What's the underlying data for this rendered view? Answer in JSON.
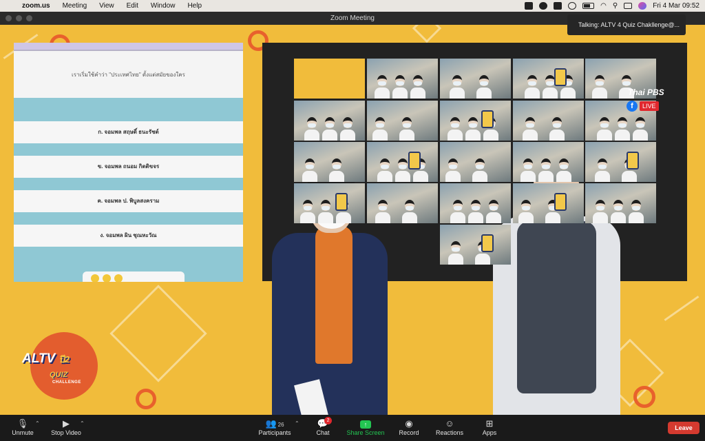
{
  "menubar": {
    "app_name": "zoom.us",
    "items": [
      "Meeting",
      "View",
      "Edit",
      "Window",
      "Help"
    ],
    "clock": "Fri 4 Mar  09:52",
    "status_icons": [
      "zoom-icon",
      "line-icon",
      "notion-icon",
      "moon-icon",
      "battery-icon",
      "wifi-icon",
      "search-icon",
      "control-center-icon",
      "siri-icon"
    ]
  },
  "window": {
    "title": "Zoom Meeting"
  },
  "quiz": {
    "question": "เราเริ่มใช้คำว่า \"ประเทศไทย\" ตั้งแต่สมัยของใคร",
    "options": [
      "ก. จอมพล สฤษดิ์ ธนะรัชต์",
      "ข. จอมพล ถนอม กิตติขจร",
      "ค. จอมพล ป. พิบูลสงคราม",
      "ง. จอมพล ผิน ชุณหะวัณ"
    ]
  },
  "gallery": {
    "talking_indicator": "Talking: ALTV 4 Quiz Chakllenge@...",
    "broadcaster": "Thai PBS",
    "live_label": "LIVE"
  },
  "logo": {
    "line1": "ALTV",
    "line2": "QUIZ",
    "line3": "CHALLENGE",
    "badge": "ปี2"
  },
  "toolbar": {
    "unmute": "Unmute",
    "stop_video": "Stop Video",
    "participants": "Participants",
    "participants_count": "26",
    "chat": "Chat",
    "chat_badge": "2",
    "share_screen": "Share Screen",
    "record": "Record",
    "reactions": "Reactions",
    "apps": "Apps",
    "leave": "Leave"
  },
  "colors": {
    "stage_bg": "#f1bc3b",
    "accent_orange": "#e8612c",
    "share_green": "#23c552",
    "leave_red": "#d43a2f"
  }
}
